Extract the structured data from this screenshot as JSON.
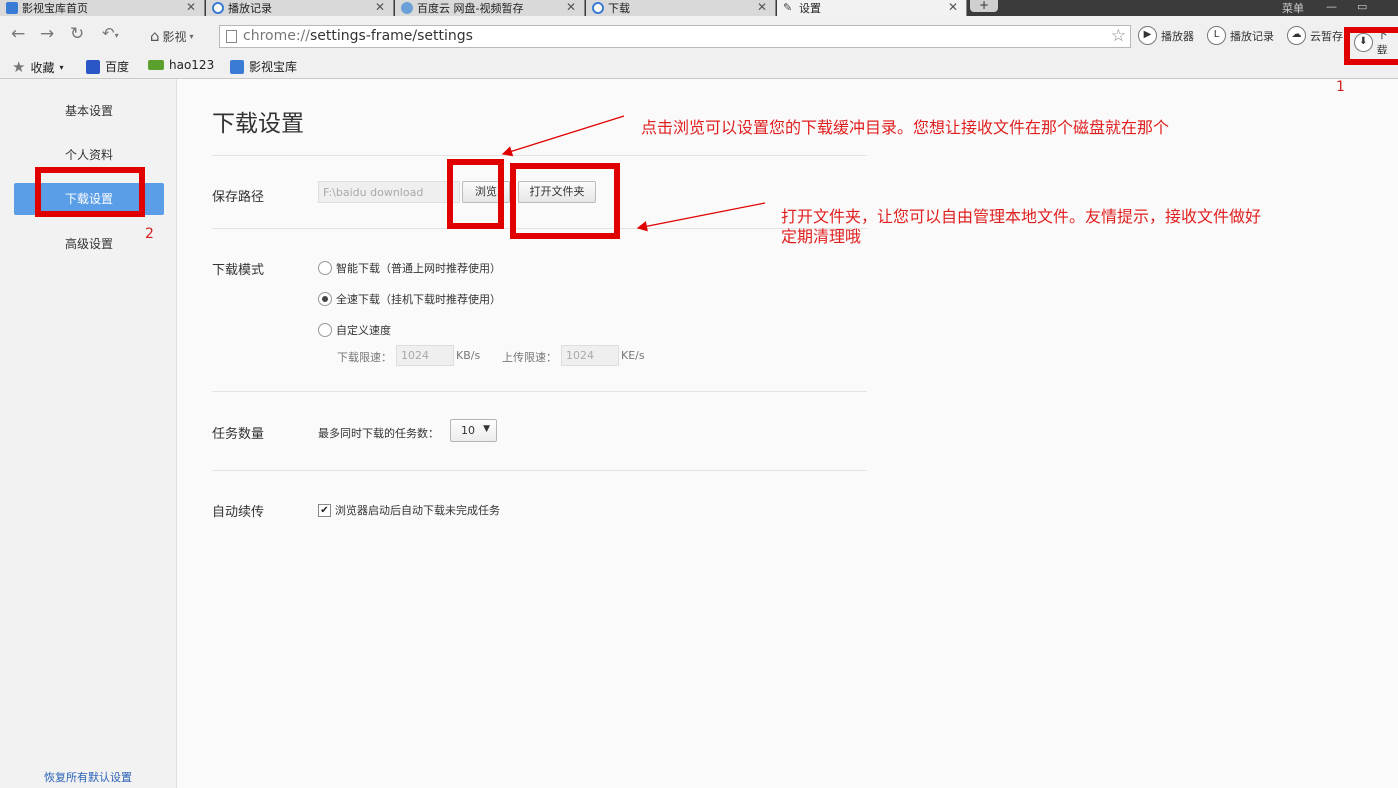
{
  "tabs": [
    {
      "label": "影视宝库首页",
      "icon": "film-icon",
      "color": "#3a7bd5"
    },
    {
      "label": "播放记录",
      "icon": "clock-icon",
      "color": "#3a7bd5"
    },
    {
      "label": "百度云 网盘-视频暂存",
      "icon": "cloud-icon",
      "color": "#3a7bd5"
    },
    {
      "label": "下载",
      "icon": "download-icon",
      "color": "#3a7bd5"
    },
    {
      "label": "设置",
      "icon": "wrench-icon",
      "color": "#444444",
      "active": true
    }
  ],
  "window": {
    "menu_label": "菜单",
    "minimize": "—",
    "maximize": "▭"
  },
  "toolbar": {
    "home_label": "影视",
    "url_prefix": "chrome://",
    "url_rest": "settings-frame/settings",
    "buttons": [
      {
        "label": "播放器",
        "icon": "play-icon"
      },
      {
        "label": "播放记录",
        "icon": "history-icon"
      },
      {
        "label": "云暂存",
        "icon": "cloud-save-icon"
      },
      {
        "label": "下载",
        "icon": "download-icon"
      }
    ]
  },
  "bookmarks": [
    {
      "label": "收藏",
      "icon": "star-icon"
    },
    {
      "label": "百度",
      "icon": "baidu-paw-icon"
    },
    {
      "label": "hao123",
      "icon": "hao123-icon"
    },
    {
      "label": "影视宝库",
      "icon": "film-icon"
    }
  ],
  "sidebar": {
    "items": [
      {
        "label": "基本设置"
      },
      {
        "label": "个人资料"
      },
      {
        "label": "下载设置",
        "active": true
      },
      {
        "label": "高级设置"
      }
    ],
    "restore_label": "恢复所有默认设置"
  },
  "main": {
    "title": "下载设置",
    "save_path": {
      "label": "保存路径",
      "value": "F:\\baidu download",
      "browse_label": "浏览",
      "open_folder_label": "打开文件夹"
    },
    "download_mode": {
      "label": "下载模式",
      "options": [
        {
          "label": "智能下载（普通上网时推荐使用）",
          "selected": false
        },
        {
          "label": "全速下载（挂机下载时推荐使用）",
          "selected": true
        },
        {
          "label": "自定义速度",
          "selected": false
        }
      ],
      "download_limit_label": "下载限速：",
      "download_limit_value": "1024",
      "download_unit": "KB/s",
      "upload_limit_label": "上传限速：",
      "upload_limit_value": "1024",
      "upload_unit": "KE/s"
    },
    "task_count": {
      "label": "任务数量",
      "desc": "最多同时下载的任务数：",
      "value": "10"
    },
    "auto_resume": {
      "label": "自动续传",
      "checkbox_label": "浏览器启动后自动下载未完成任务",
      "checked": true
    }
  },
  "annotations": {
    "note_browse": "点击浏览可以设置您的下载缓冲目录。您想让接收文件在那个磁盘就在那个",
    "note_open_line1": "打开文件夹，让您可以自由管理本地文件。友情提示，接收文件做好",
    "note_open_line2": "定期清理哦",
    "num1": "1",
    "num2": "2",
    "color": "#e00000"
  }
}
